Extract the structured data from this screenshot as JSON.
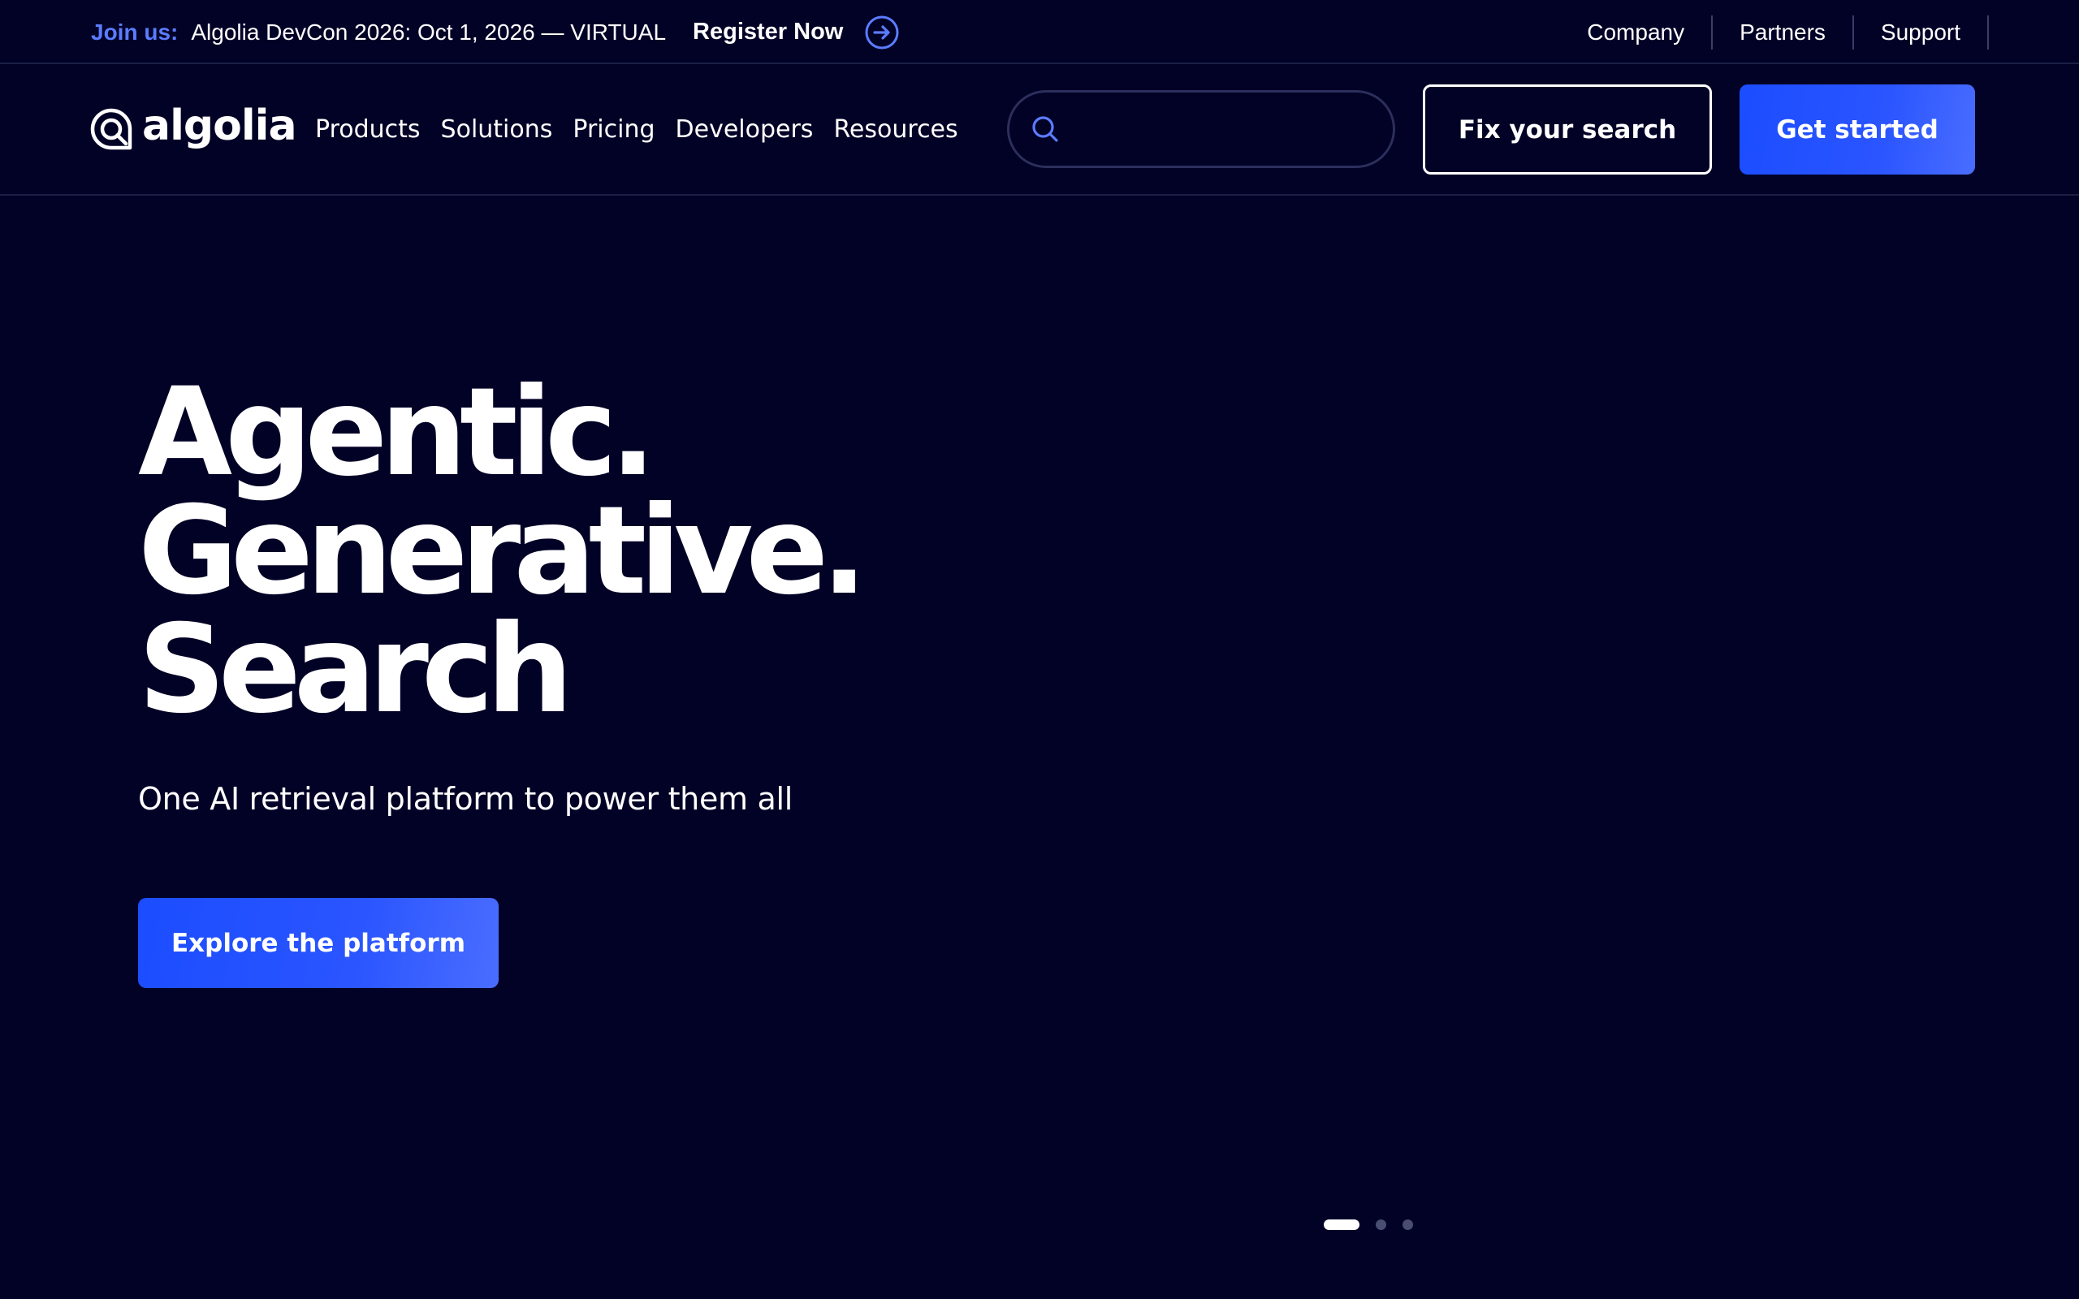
{
  "announcement": {
    "label": "Join us:",
    "event": "Algolia DevCon 2026: Oct 1, 2026 — VIRTUAL",
    "cta": "Register Now",
    "icon": "arrow-right-circle-icon"
  },
  "utility_nav": [
    {
      "label": "Company"
    },
    {
      "label": "Partners"
    },
    {
      "label": "Support"
    }
  ],
  "logo": {
    "text": "algolia",
    "icon": "algolia-logo-icon"
  },
  "main_nav": [
    {
      "label": "Products"
    },
    {
      "label": "Solutions"
    },
    {
      "label": "Pricing"
    },
    {
      "label": "Developers"
    },
    {
      "label": "Resources"
    }
  ],
  "search": {
    "placeholder": "",
    "value": "",
    "icon": "search-icon"
  },
  "buttons": {
    "fix_search": "Fix your search",
    "get_started": "Get started"
  },
  "hero": {
    "headline": [
      "Agentic.",
      "Generative.",
      "Search"
    ],
    "subtitle": "One AI retrieval platform to power them all",
    "cta": "Explore the platform"
  },
  "carousel": {
    "total": 3,
    "active": 1
  },
  "colors": {
    "background": "#020126",
    "accent": "#5b7cff",
    "primary_button": "#1b4dff",
    "text": "#ffffff"
  }
}
